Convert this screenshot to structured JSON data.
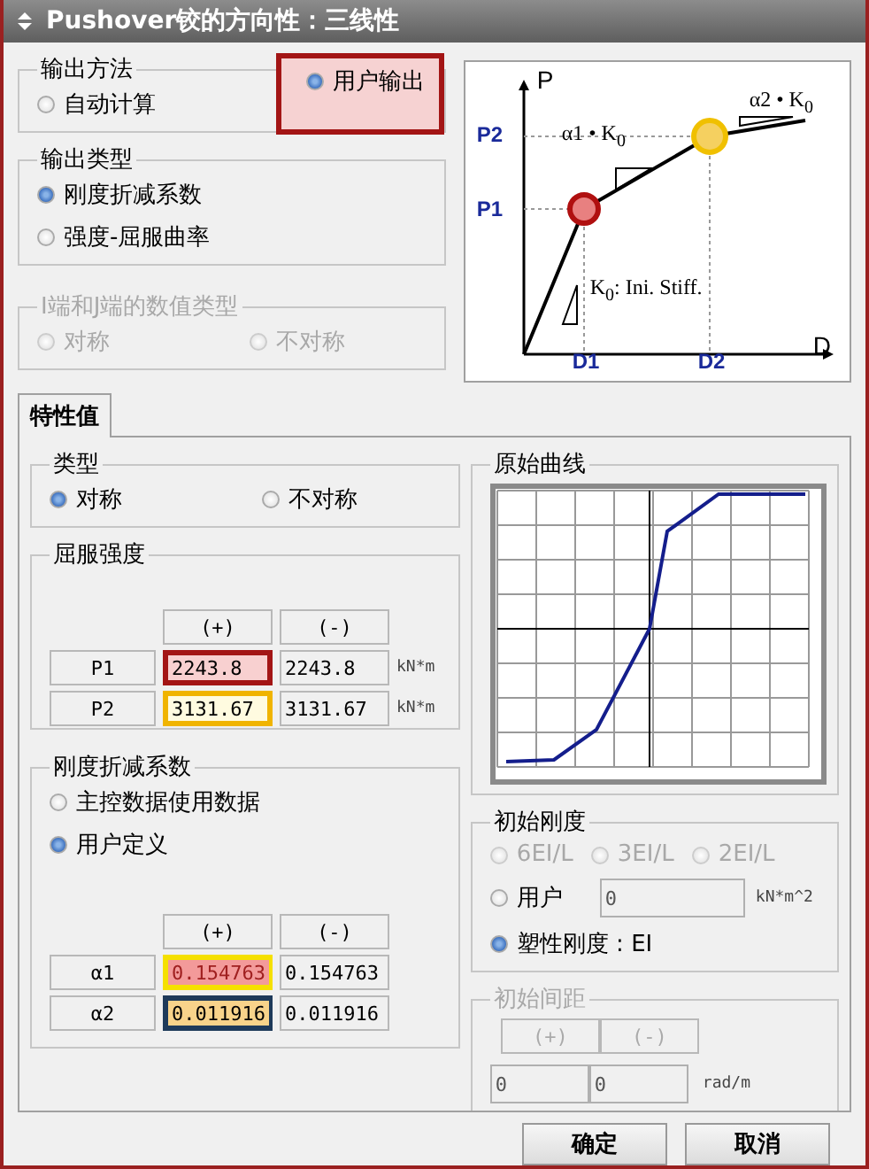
{
  "window": {
    "title": "Pushover铰的方向性：三线性"
  },
  "output_method": {
    "title": "输出方法",
    "options": [
      {
        "label": "自动计算",
        "selected": false
      },
      {
        "label": "用户输出",
        "selected": true,
        "color": "#a31515"
      }
    ]
  },
  "output_type": {
    "title": "输出类型",
    "options": [
      {
        "label": "刚度折减系数",
        "selected": true
      },
      {
        "label": "强度-屈服曲率",
        "selected": false
      }
    ]
  },
  "end_value_type": {
    "title": "I端和J端的数值类型",
    "disabled": true,
    "options": [
      {
        "label": "对称",
        "selected": false
      },
      {
        "label": "不对称",
        "selected": false
      }
    ]
  },
  "diagram": {
    "labels": [
      {
        "kind": "axis",
        "text": "P"
      },
      {
        "kind": "tick",
        "text": "P2"
      },
      {
        "kind": "tick",
        "text": "P1"
      },
      {
        "kind": "axis",
        "text": "D"
      },
      {
        "kind": "tick",
        "text": "D1"
      },
      {
        "kind": "tick",
        "text": "D2"
      },
      {
        "kind": "note",
        "text": "α1 • K$_{0}$"
      },
      {
        "kind": "note",
        "text": "α2 • K$_{0}$"
      },
      {
        "kind": "note",
        "text": "K$_{0}$: Ini.  Stiff."
      }
    ]
  },
  "tabs": [
    {
      "label": "特性值",
      "selected": true
    }
  ],
  "type": {
    "title": "类型",
    "options": [
      {
        "label": "对称",
        "selected": true
      },
      {
        "label": "不对称",
        "selected": false
      }
    ]
  },
  "yield_strength": {
    "title": "屈服强度",
    "columns": [
      "(+)",
      "(-)"
    ],
    "rows": [
      {
        "label": "P1",
        "unit": "kN*m",
        "values": [
          {
            "value": "2243.8",
            "frame": {
              "color": "#a31515"
            },
            "color": "#f8d0d0"
          },
          {
            "value": "2243.8"
          }
        ]
      },
      {
        "label": "P2",
        "unit": "kN*m",
        "values": [
          {
            "value": "3131.67",
            "frame": {
              "color": "#f0b400"
            },
            "color": "#fffbe0"
          },
          {
            "value": "3131.67"
          }
        ]
      }
    ]
  },
  "stiffness_reduction": {
    "title": "刚度折减系数",
    "options": [
      {
        "label": "主控数据使用数据",
        "selected": false
      },
      {
        "label": "用户定义",
        "selected": true
      }
    ],
    "columns": [
      "(+)",
      "(-)"
    ],
    "rows": [
      {
        "label": "α1",
        "values": [
          {
            "value": "0.154763",
            "frame": {
              "color": "#f5e000"
            },
            "color": "#f39a9a"
          },
          {
            "value": "0.154763"
          }
        ]
      },
      {
        "label": "α2",
        "values": [
          {
            "value": "0.011916",
            "frame": {
              "color": "#1e3a5a"
            },
            "color": "#f8d38a"
          },
          {
            "value": "0.011916"
          }
        ]
      }
    ]
  },
  "original_curve": {
    "title": "原始曲线"
  },
  "initial_stiffness": {
    "title": "初始刚度",
    "options": [
      {
        "kind": "inline",
        "label": "6EI/L",
        "selected": false,
        "disabled": true
      },
      {
        "kind": "inline",
        "label": "3EI/L",
        "selected": false,
        "disabled": true
      },
      {
        "kind": "inline",
        "label": "2EI/L",
        "selected": false,
        "disabled": true
      },
      {
        "kind": "input",
        "label": "用户",
        "selected": false,
        "disabled": false,
        "value": "0",
        "unit": "kN*m^2"
      },
      {
        "kind": "plain",
        "label": "塑性刚度 : EI",
        "selected": true,
        "disabled": false
      }
    ]
  },
  "initial_gap": {
    "title": "初始间距",
    "disabled": true,
    "columns": [
      "(+)",
      "(-)"
    ],
    "values": [
      "0",
      "0"
    ],
    "unit": "rad/m"
  },
  "buttons": [
    {
      "label": "确定"
    },
    {
      "label": "取消"
    }
  ]
}
